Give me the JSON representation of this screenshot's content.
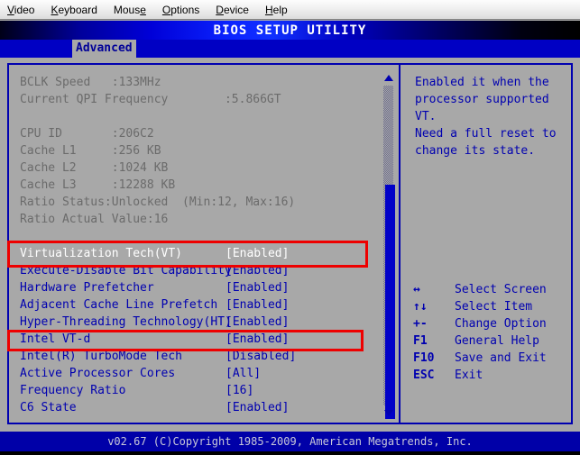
{
  "menubar": {
    "items": [
      {
        "name": "video",
        "pre": "",
        "mn": "V",
        "post": "ideo"
      },
      {
        "name": "keyboard",
        "pre": "",
        "mn": "K",
        "post": "eyboard"
      },
      {
        "name": "mouse",
        "pre": "Mous",
        "mn": "e",
        "post": ""
      },
      {
        "name": "options",
        "pre": "",
        "mn": "O",
        "post": "ptions"
      },
      {
        "name": "device",
        "pre": "",
        "mn": "D",
        "post": "evice"
      },
      {
        "name": "help",
        "pre": "",
        "mn": "H",
        "post": "elp"
      }
    ]
  },
  "titlebar": {
    "title": "BIOS SETUP UTILITY"
  },
  "tabs": {
    "active": "Advanced"
  },
  "main": {
    "rows": [
      {
        "type": "info",
        "text": "BCLK Speed   :133MHz"
      },
      {
        "type": "info",
        "text": "Current QPI Frequency        :5.866GT"
      },
      {
        "type": "blank",
        "text": ""
      },
      {
        "type": "info",
        "text": "CPU ID       :206C2"
      },
      {
        "type": "info",
        "text": "Cache L1     :256 KB"
      },
      {
        "type": "info",
        "text": "Cache L2     :1024 KB"
      },
      {
        "type": "info",
        "text": "Cache L3     :12288 KB"
      },
      {
        "type": "info",
        "text": "Ratio Status:Unlocked  (Min:12, Max:16)"
      },
      {
        "type": "info",
        "text": "Ratio Actual Value:16"
      },
      {
        "type": "blank",
        "text": ""
      },
      {
        "type": "sel",
        "label": "Virtualization Tech(VT)",
        "value": "[Enabled]"
      },
      {
        "type": "option",
        "label": "Execute-Disable Bit Capability",
        "value": "[Enabled]"
      },
      {
        "type": "option",
        "label": "Hardware Prefetcher",
        "value": "[Enabled]"
      },
      {
        "type": "option",
        "label": "Adjacent Cache Line Prefetch",
        "value": "[Enabled]"
      },
      {
        "type": "option",
        "label": "Hyper-Threading Technology(HT)",
        "value": "[Enabled]"
      },
      {
        "type": "option",
        "label": "Intel VT-d",
        "value": "[Enabled]"
      },
      {
        "type": "option",
        "label": "Intel(R) TurboMode Tech",
        "value": "[Disabled]"
      },
      {
        "type": "option",
        "label": "Active Processor Cores",
        "value": "[All]"
      },
      {
        "type": "option",
        "label": "Frequency Ratio",
        "value": "[16]"
      },
      {
        "type": "option",
        "label": "C6 State",
        "value": "[Enabled]"
      }
    ]
  },
  "scrollbar": {
    "up_arrow": "scroll-up-arrow",
    "down_arrow": "scroll-down-arrow"
  },
  "help": {
    "lines": [
      "Enabled it when the",
      "processor supported",
      "VT.",
      "Need a full reset to",
      "change its state."
    ]
  },
  "legend": {
    "rows": [
      {
        "key": "↔",
        "desc": "Select Screen"
      },
      {
        "key": "↑↓",
        "desc": "Select Item"
      },
      {
        "key": "+-",
        "desc": "Change Option"
      },
      {
        "key": "F1",
        "desc": "General Help"
      },
      {
        "key": "F10",
        "desc": "Save and Exit"
      },
      {
        "key": "ESC",
        "desc": "Exit"
      }
    ]
  },
  "footer": {
    "copyright": "v02.67 (C)Copyright 1985-2009, American Megatrends, Inc."
  },
  "annotations": [
    {
      "name": "virtualization-tech-highlight",
      "color": "#ee0000"
    },
    {
      "name": "intel-vtd-highlight",
      "color": "#ee0000"
    }
  ],
  "colors": {
    "bios_blue": "#0000b0",
    "bios_bg": "#a8a8a8",
    "title_text": "#ffffff",
    "annotation_red": "#ee0000",
    "info_gray": "#6b6b6b"
  }
}
